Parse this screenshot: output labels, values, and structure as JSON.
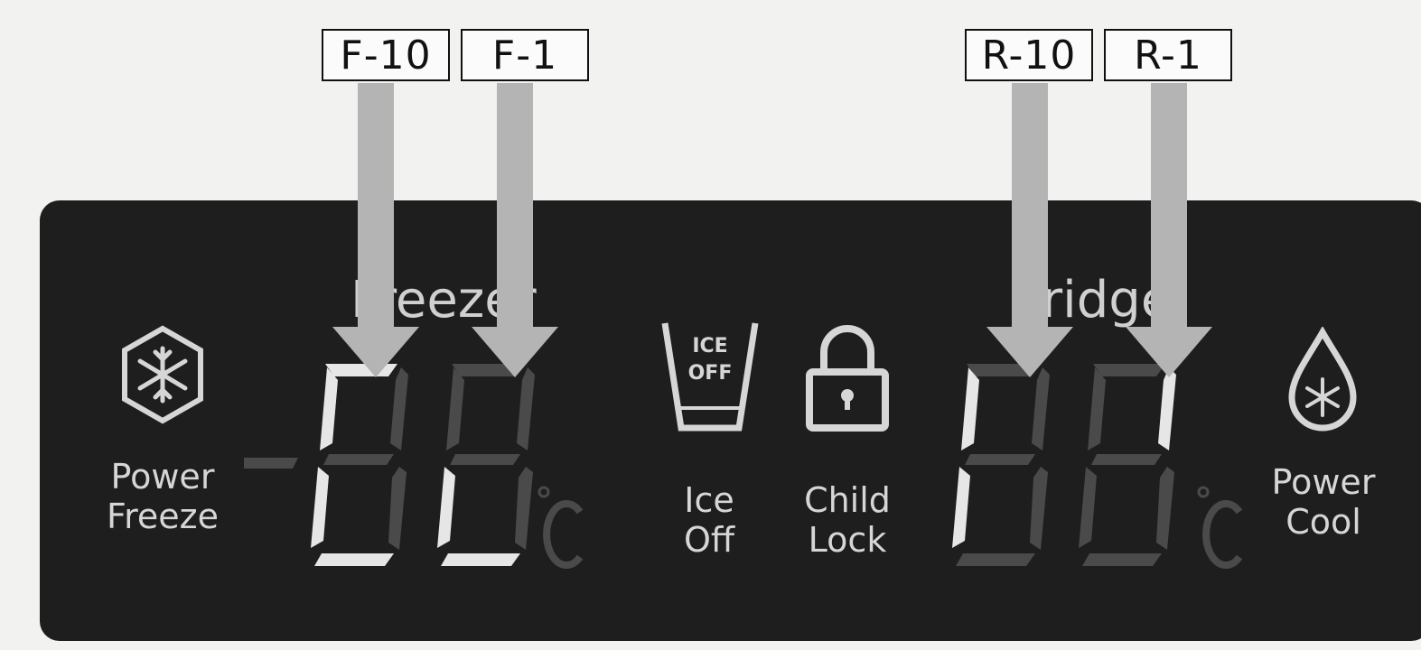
{
  "callouts": {
    "f10": "F-10",
    "f1": "F-1",
    "r10": "R-10",
    "r1": "R-1"
  },
  "panel": {
    "freezer_title": "Freezer",
    "fridge_title": "Fridge",
    "power_freeze": [
      "Power",
      "Freeze"
    ],
    "ice_off": [
      "Ice",
      "Off"
    ],
    "ice_icon_text": [
      "ICE",
      "OFF"
    ],
    "child_lock": [
      "Child",
      "Lock"
    ],
    "power_cool": [
      "Power",
      "Cool"
    ],
    "unit": "°C"
  },
  "colors": {
    "panel": "#1e1e1e",
    "segment_lit": "#e6e6e6",
    "segment_dim": "#4a4a4a",
    "arrow": "#b4b4b4"
  }
}
